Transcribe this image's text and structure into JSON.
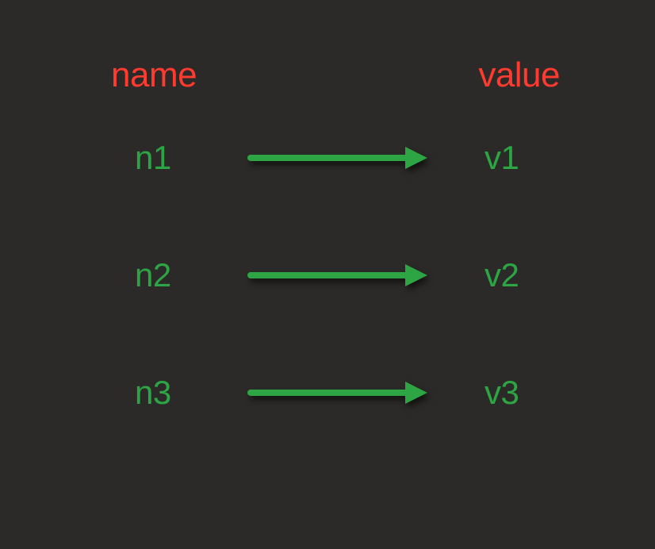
{
  "headers": {
    "name": "name",
    "value": "value"
  },
  "mappings": [
    {
      "name": "n1",
      "value": "v1"
    },
    {
      "name": "n2",
      "value": "v2"
    },
    {
      "name": "n3",
      "value": "v3"
    }
  ],
  "colors": {
    "header": "#ff3b30",
    "item": "#2da544",
    "arrow": "#2da544",
    "background": "#2b2a28"
  }
}
